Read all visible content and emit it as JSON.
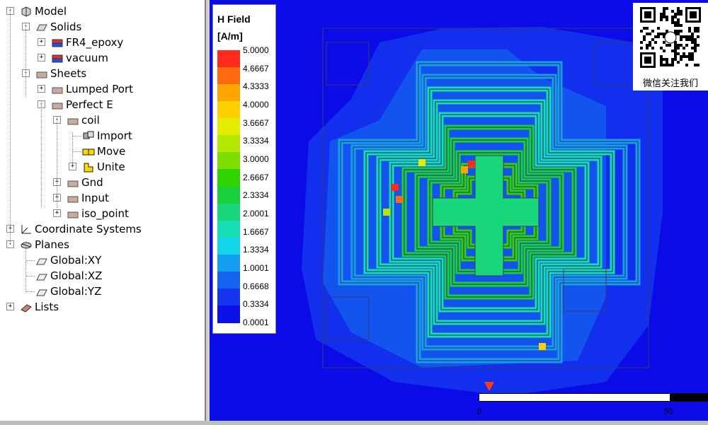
{
  "tree": {
    "items": [
      {
        "label": "Model",
        "icon": "model-icon",
        "level": 0,
        "expander": "-"
      },
      {
        "label": "Solids",
        "icon": "solids-icon",
        "level": 1,
        "expander": "-"
      },
      {
        "label": "FR4_epoxy",
        "icon": "material-icon",
        "level": 2,
        "expander": "+"
      },
      {
        "label": "vacuum",
        "icon": "material-icon",
        "level": 2,
        "expander": "+"
      },
      {
        "label": "Sheets",
        "icon": "sheet-icon",
        "level": 1,
        "expander": "-"
      },
      {
        "label": "Lumped Port",
        "icon": "sheet-icon",
        "level": 2,
        "expander": "+"
      },
      {
        "label": "Perfect E",
        "icon": "sheet-icon",
        "level": 2,
        "expander": "-"
      },
      {
        "label": "coil",
        "icon": "sheet-icon",
        "level": 3,
        "expander": "-"
      },
      {
        "label": "Import",
        "icon": "import-icon",
        "level": 4,
        "expander": ""
      },
      {
        "label": "Move",
        "icon": "move-icon",
        "level": 4,
        "expander": ""
      },
      {
        "label": "Unite",
        "icon": "unite-icon",
        "level": 4,
        "expander": "+"
      },
      {
        "label": "Gnd",
        "icon": "sheet-icon",
        "level": 3,
        "expander": "+"
      },
      {
        "label": "Input",
        "icon": "sheet-icon",
        "level": 3,
        "expander": "+"
      },
      {
        "label": "iso_point",
        "icon": "sheet-icon",
        "level": 3,
        "expander": "+"
      },
      {
        "label": "Coordinate Systems",
        "icon": "coordinate-systems-icon",
        "level": 0,
        "expander": "+"
      },
      {
        "label": "Planes",
        "icon": "planes-icon",
        "level": 0,
        "expander": "-"
      },
      {
        "label": "Global:XY",
        "icon": "plane-icon",
        "level": 1,
        "expander": ""
      },
      {
        "label": "Global:XZ",
        "icon": "plane-icon",
        "level": 1,
        "expander": ""
      },
      {
        "label": "Global:YZ",
        "icon": "plane-icon",
        "level": 1,
        "expander": ""
      },
      {
        "label": "Lists",
        "icon": "lists-icon",
        "level": 0,
        "expander": "+"
      }
    ]
  },
  "legend": {
    "title": "H Field",
    "unit": "[A/m]",
    "ticks": [
      "5.0000",
      "4.6667",
      "4.3333",
      "4.0000",
      "3.6667",
      "3.3334",
      "3.0000",
      "2.6667",
      "2.3334",
      "2.0001",
      "1.6667",
      "1.3334",
      "1.0001",
      "0.6668",
      "0.3334",
      "0.0001"
    ],
    "colors": [
      "#ff2a1a",
      "#ff6a10",
      "#ffa400",
      "#ffd000",
      "#e6ec00",
      "#b4e800",
      "#7ede00",
      "#2ed400",
      "#18d03a",
      "#1ad67a",
      "#16ddb4",
      "#12d6e8",
      "#149ef0",
      "#1464f0",
      "#1436ee",
      "#0c10e8"
    ]
  },
  "qr": {
    "caption": "微信关注我们"
  },
  "scale": {
    "start": "0",
    "end": "50"
  },
  "colors": {
    "background": "#0b0be8",
    "marker": "#ff3a1a"
  }
}
